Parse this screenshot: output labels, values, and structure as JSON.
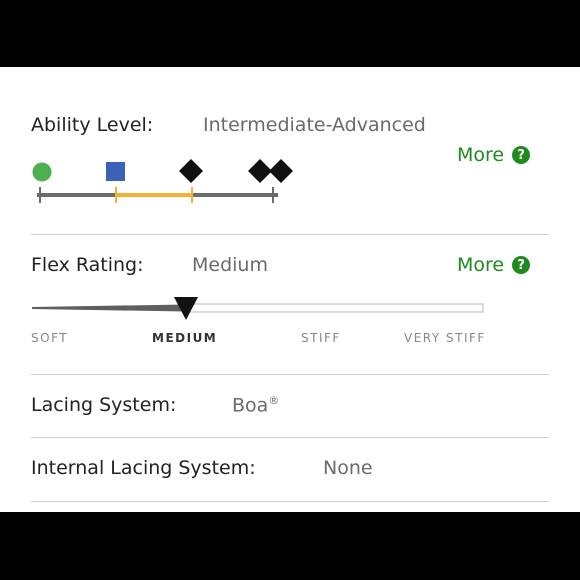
{
  "ability": {
    "label": "Ability Level:",
    "value": "Intermediate-Advanced",
    "more_label": "More",
    "help_glyph": "?",
    "levels": [
      "beginner-green-circle-icon",
      "intermediate-blue-square-icon",
      "advanced-black-diamond-icon",
      "expert-double-black-diamond-icon"
    ],
    "highlight_range": [
      "intermediate",
      "advanced"
    ],
    "colors": {
      "track": "#6b6b6b",
      "highlight": "#f2b233",
      "green": "#4caf50",
      "blue": "#3a63b8",
      "black": "#111111"
    }
  },
  "flex": {
    "label": "Flex Rating:",
    "value": "Medium",
    "more_label": "More",
    "help_glyph": "?",
    "ticks": [
      "SOFT",
      "MEDIUM",
      "STIFF",
      "VERY STIFF"
    ],
    "selected_index": 1
  },
  "lacing": {
    "label": "Lacing System:",
    "value": "Boa",
    "value_mark": "®"
  },
  "internal_lacing": {
    "label": "Internal Lacing System:",
    "value": "None"
  },
  "colors": {
    "link": "#1f8a1f",
    "frame": "#000000",
    "panel": "#ffffff"
  }
}
